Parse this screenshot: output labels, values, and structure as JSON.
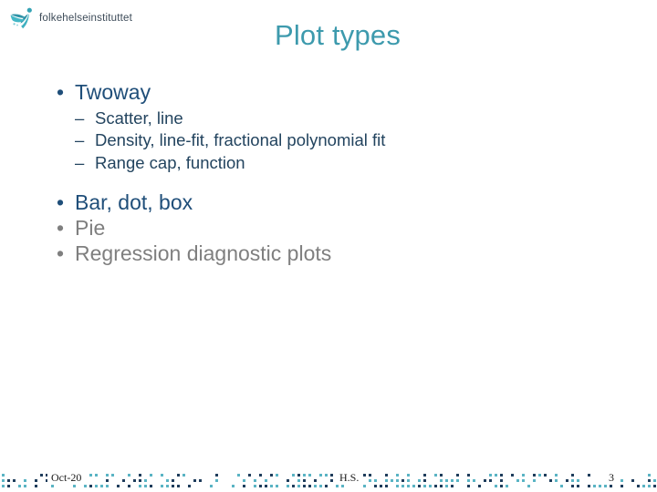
{
  "slide": {
    "title": "Plot types",
    "logo": {
      "wordmark": "folkehelseinstituttet",
      "mark_icon": "running-figure-icon"
    },
    "colors": {
      "title_teal": "#3d9aad",
      "bullet_navy": "#1f4e79",
      "subbullet_slate": "#23445f",
      "muted_gray": "#7f7f7f",
      "dot_teal": "#5ab4c4",
      "dot_navy": "#1f3d5c",
      "logo_text": "#3c4a58"
    },
    "bullets": [
      {
        "text": "Twoway",
        "marker": "•",
        "muted": false,
        "children": [
          {
            "text": "Scatter, line",
            "marker": "–"
          },
          {
            "text": "Density, line-fit, fractional polynomial fit",
            "marker": "–"
          },
          {
            "text": "Range cap, function",
            "marker": "–"
          }
        ]
      },
      {
        "text": "Bar, dot, box",
        "marker": "•",
        "muted": false,
        "children": []
      },
      {
        "text": "Pie",
        "marker": "•",
        "muted": true,
        "children": []
      },
      {
        "text": "Regression diagnostic plots",
        "marker": "•",
        "muted": true,
        "children": []
      }
    ],
    "footer": {
      "date": "Oct-20",
      "center": "H.S.",
      "page_number": "3"
    }
  }
}
